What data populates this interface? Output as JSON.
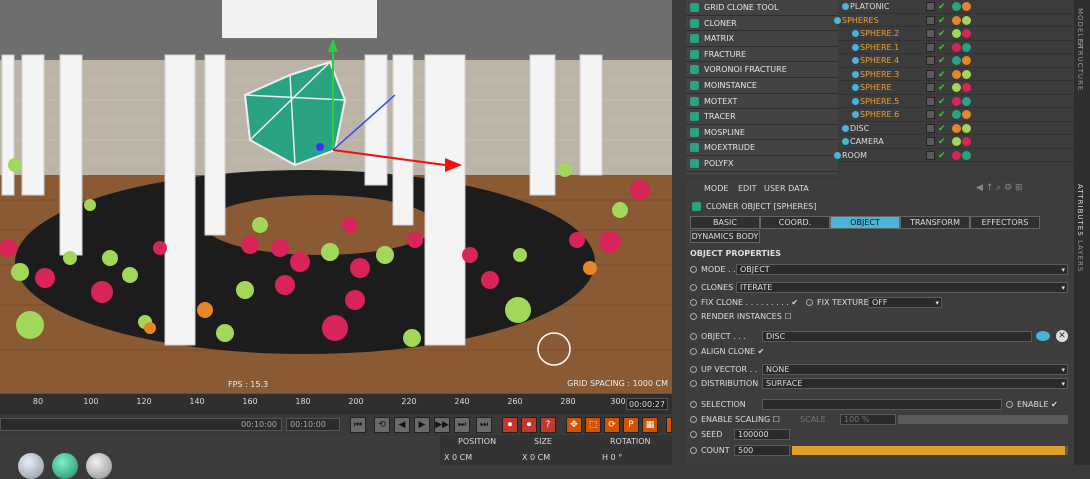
{
  "viewport": {
    "fps": "FPS : 15.3",
    "grid_spacing": "GRID SPACING : 1000 CM"
  },
  "timeline": {
    "ticks": [
      "80",
      "100",
      "120",
      "140",
      "160",
      "180",
      "200",
      "220",
      "240",
      "260",
      "280",
      "300"
    ],
    "end_frame": "00:00:27"
  },
  "transport": {
    "time_a": "00:10:00",
    "time_b": "00:10:00",
    "buttons": [
      "⏮",
      "⟲",
      "◀",
      "▶",
      "▶▶",
      "⏭",
      "⏺",
      "⏺",
      "?",
      "✥",
      "⬚",
      "⟳",
      "P",
      "▦",
      "⏸"
    ]
  },
  "coords": {
    "position_label": "POSITION",
    "size_label": "SIZE",
    "rotation_label": "ROTATION",
    "x_pos": "X  0 CM",
    "x_size": "X  0 CM",
    "h_rot": "H  0 °"
  },
  "menu": {
    "items": [
      {
        "label": "GRID CLONE TOOL",
        "icon": "grid-clone-icon"
      },
      {
        "label": "CLONER",
        "icon": "cloner-icon"
      },
      {
        "label": "MATRIX",
        "icon": "matrix-icon"
      },
      {
        "label": "FRACTURE",
        "icon": "fracture-icon"
      },
      {
        "label": "VORONOI FRACTURE",
        "icon": "voronoi-icon"
      },
      {
        "label": "MOINSTANCE",
        "icon": "moinstance-icon"
      },
      {
        "label": "MOTEXT",
        "icon": "motext-icon"
      },
      {
        "label": "TRACER",
        "icon": "tracer-icon"
      },
      {
        "label": "MOSPLINE",
        "icon": "mospline-icon"
      },
      {
        "label": "MOEXTRUDE",
        "icon": "moextrude-icon"
      },
      {
        "label": "POLYFX",
        "icon": "polyfx-icon"
      }
    ]
  },
  "objects": [
    {
      "name": "PLATONIC",
      "indent": 12,
      "color": "#dddddd"
    },
    {
      "name": "SPHERES",
      "indent": 4,
      "color": "#f0a030"
    },
    {
      "name": "SPHERE.2",
      "indent": 22,
      "color": "#f0a030"
    },
    {
      "name": "SPHERE.1",
      "indent": 22,
      "color": "#f0a030"
    },
    {
      "name": "SPHERE.4",
      "indent": 22,
      "color": "#f0a030"
    },
    {
      "name": "SPHERE.3",
      "indent": 22,
      "color": "#f0a030"
    },
    {
      "name": "SPHERE",
      "indent": 22,
      "color": "#f0a030"
    },
    {
      "name": "SPHERE.5",
      "indent": 22,
      "color": "#f0a030"
    },
    {
      "name": "SPHERE.6",
      "indent": 22,
      "color": "#f0a030"
    },
    {
      "name": "DISC",
      "indent": 12,
      "color": "#dddddd"
    },
    {
      "name": "CAMERA",
      "indent": 12,
      "color": "#dddddd"
    },
    {
      "name": "ROOM",
      "indent": 4,
      "color": "#dddddd"
    }
  ],
  "side_tabs": [
    "MODELER",
    "STRUCTURE",
    "ATTRIBUTES",
    "LAYERS"
  ],
  "attributes": {
    "menu": [
      "MODE",
      "EDIT",
      "USER DATA"
    ],
    "title": "CLONER OBJECT [SPHERES]",
    "tabs": [
      "BASIC",
      "COORD.",
      "OBJECT",
      "TRANSFORM",
      "EFFECTORS",
      "DYNAMICS BODY"
    ],
    "active_tab": "OBJECT",
    "section": "OBJECT PROPERTIES",
    "mode_label": "MODE . . .",
    "mode_value": "OBJECT",
    "clones_label": "CLONES",
    "clones_value": "ITERATE",
    "fix_clone": "FIX CLONE . . . . . . . . .",
    "fix_texture": "FIX TEXTURE",
    "fix_texture_value": "OFF",
    "render_instances": "RENDER INSTANCES",
    "object_label": "OBJECT . . .",
    "object_value": "DISC",
    "align_clone": "ALIGN CLONE",
    "up_vector_label": "UP VECTOR . .",
    "up_vector_value": "NONE",
    "distribution_label": "DISTRIBUTION",
    "distribution_value": "SURFACE",
    "selection_label": "SELECTION",
    "enable_label": "ENABLE",
    "enable_scaling": "ENABLE SCALING",
    "scale_label": "SCALE",
    "scale_value": "100 %",
    "seed_label": "SEED",
    "seed_value": "100000",
    "count_label": "COUNT",
    "count_value": "500",
    "count_fraction": 0.99
  }
}
